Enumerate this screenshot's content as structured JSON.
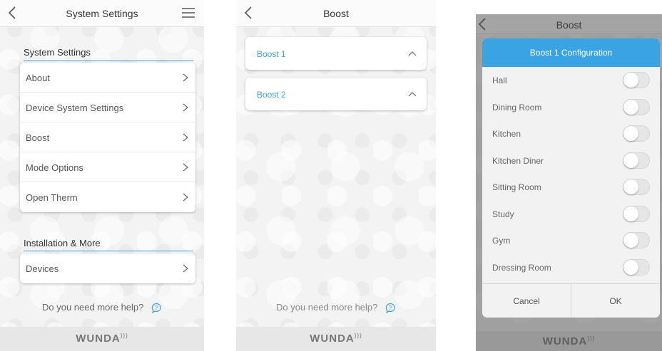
{
  "screen1": {
    "title": "System Settings",
    "section1_title": "System Settings",
    "section1_items": [
      "About",
      "Device System Settings",
      "Boost",
      "Mode Options",
      "Open Therm"
    ],
    "section2_title": "Installation & More",
    "section2_items": [
      "Devices"
    ],
    "help_text": "Do you need more help?",
    "footer_logo": "WUNDA"
  },
  "screen2": {
    "title": "Boost",
    "items": [
      "Boost 1",
      "Boost 2"
    ],
    "help_text": "Do you need more help?",
    "footer_logo": "WUNDA"
  },
  "screen3": {
    "title": "Boost",
    "modal_title": "Boost 1 Configuration",
    "rooms": [
      "Hall",
      "Dining Room",
      "Kitchen",
      "Kitchen Diner",
      "Sitting Room",
      "Study",
      "Gym",
      "Dressing Room"
    ],
    "cancel_label": "Cancel",
    "ok_label": "OK",
    "footer_logo": "WUNDA"
  },
  "icons": {
    "back": "chevron-left-icon",
    "menu": "hamburger-menu-icon",
    "row_arrow": "chevron-right-icon",
    "expand": "chevron-up-icon",
    "help": "help-bubble-icon"
  },
  "colors": {
    "accent": "#3aa3e3",
    "footer_bg": "#e7e7e7"
  }
}
